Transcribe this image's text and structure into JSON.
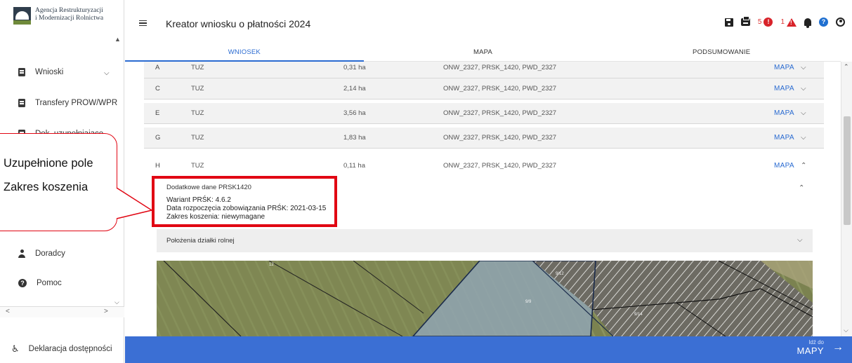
{
  "sidebar": {
    "logo_line1": "Agencja Restrukturyzacji",
    "logo_line2": "i Modernizacji Rolnictwa",
    "items": [
      {
        "label": "Wnioski"
      },
      {
        "label": "Transfery PROW/WPR"
      },
      {
        "label": "Dok. uzupełniające"
      },
      {
        "label": "Doradcy"
      },
      {
        "label": "Pomoc"
      }
    ],
    "accessibility": "Deklaracja dostępności"
  },
  "header": {
    "title": "Kreator wniosku o płatności 2024",
    "error_count": "5",
    "warning_count": "1",
    "icons": [
      "save-icon",
      "print-icon",
      "error-icon",
      "warning-icon",
      "bell-icon",
      "help-icon",
      "user-icon"
    ]
  },
  "tabs": [
    {
      "label": "WNIOSEK",
      "active": true
    },
    {
      "label": "MAPA",
      "active": false
    },
    {
      "label": "PODSUMOWANIE",
      "active": false
    }
  ],
  "parcels": [
    {
      "id": "A",
      "type": "TUZ",
      "area": "0,31 ha",
      "codes": "ONW_2327, PRSK_1420, PWD_2327",
      "map": "MAPA"
    },
    {
      "id": "C",
      "type": "TUZ",
      "area": "2,14 ha",
      "codes": "ONW_2327, PRSK_1420, PWD_2327",
      "map": "MAPA"
    },
    {
      "id": "E",
      "type": "TUZ",
      "area": "3,56 ha",
      "codes": "ONW_2327, PRSK_1420, PWD_2327",
      "map": "MAPA"
    },
    {
      "id": "G",
      "type": "TUZ",
      "area": "1,83 ha",
      "codes": "ONW_2327, PRSK_1420, PWD_2327",
      "map": "MAPA"
    },
    {
      "id": "H",
      "type": "TUZ",
      "area": "0,11 ha",
      "codes": "ONW_2327, PRSK_1420, PWD_2327",
      "map": "MAPA"
    }
  ],
  "details": {
    "title": "Dodatkowe dane PRSK1420",
    "variant": "Wariant PRŚK: 4.6.2",
    "start_date": "Data rozpoczęcia zobowiązania PRŚK: 2021-03-15",
    "mowing": "Zakres koszenia: niewymagane"
  },
  "location_section": "Położenia działki rolnej",
  "map_labels": [
    "12",
    "9/12",
    "9/9",
    "9/14"
  ],
  "callout": {
    "line1": "Uzupełnione pole",
    "line2": "Zakres koszenia"
  },
  "footer": {
    "next_small": "Idź do",
    "next_big": "MAPY"
  },
  "colors": {
    "accent": "#3b6fd4",
    "highlight": "#e10613",
    "link": "#2a6bd1"
  }
}
